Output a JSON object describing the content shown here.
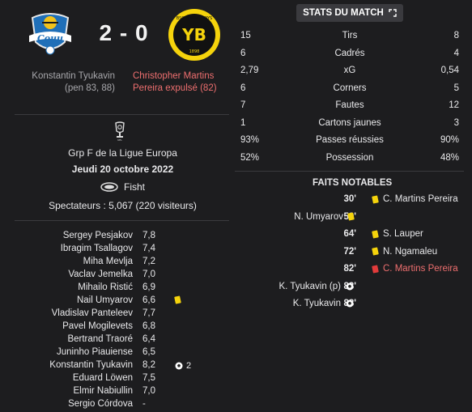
{
  "match": {
    "score": "2 - 0",
    "home_scorers": [
      "Konstantin Tyukavin",
      "(pen 83, 88)"
    ],
    "away_dismissal": [
      "Christopher Martins",
      "Pereira expulsé (82)"
    ],
    "competition": "Grp F de la Ligue Europa",
    "date": "Jeudi 20 octobre 2022",
    "stadium": "Fisht",
    "spectators": "Spectateurs : 5,067 (220 visiteurs)"
  },
  "players": [
    {
      "name": "Sergey Pesjakov",
      "rating": "7,8",
      "event": "",
      "event_icon": ""
    },
    {
      "name": "Ibragim Tsallagov",
      "rating": "7,4",
      "event": "",
      "event_icon": ""
    },
    {
      "name": "Miha Mevlja",
      "rating": "7,2",
      "event": "",
      "event_icon": ""
    },
    {
      "name": "Vaclav Jemelka",
      "rating": "7,0",
      "event": "",
      "event_icon": ""
    },
    {
      "name": "Mihailo Ristić",
      "rating": "6,9",
      "event": "",
      "event_icon": ""
    },
    {
      "name": "Nail Umyarov",
      "rating": "6,6",
      "event": "",
      "event_icon": "yellow-card-icon"
    },
    {
      "name": "Vladislav Panteleev",
      "rating": "7,7",
      "event": "",
      "event_icon": ""
    },
    {
      "name": "Pavel Mogilevets",
      "rating": "6,8",
      "event": "",
      "event_icon": ""
    },
    {
      "name": "Bertrand Traoré",
      "rating": "6,4",
      "event": "",
      "event_icon": ""
    },
    {
      "name": "Juninho Piauiense",
      "rating": "6,5",
      "event": "",
      "event_icon": ""
    },
    {
      "name": "Konstantin Tyukavin",
      "rating": "8,2",
      "event": "2",
      "event_icon": "ball-icon"
    },
    {
      "name": "Eduard Löwen",
      "rating": "7,5",
      "event": "",
      "event_icon": ""
    },
    {
      "name": "Elmir Nabiullin",
      "rating": "7,0",
      "event": "",
      "event_icon": ""
    },
    {
      "name": "Sergio Córdova",
      "rating": "-",
      "event": "",
      "event_icon": ""
    }
  ],
  "stats_title": "STATS DU MATCH",
  "stats": [
    {
      "home": "15",
      "label": "Tirs",
      "away": "8"
    },
    {
      "home": "6",
      "label": "Cadrés",
      "away": "4"
    },
    {
      "home": "2,79",
      "label": "xG",
      "away": "0,54"
    },
    {
      "home": "6",
      "label": "Corners",
      "away": "5"
    },
    {
      "home": "7",
      "label": "Fautes",
      "away": "12"
    },
    {
      "home": "1",
      "label": "Cartons jaunes",
      "away": "3"
    },
    {
      "home": "93%",
      "label": "Passes réussies",
      "away": "90%"
    },
    {
      "home": "52%",
      "label": "Possession",
      "away": "48%"
    }
  ],
  "notable_title": "FAITS NOTABLES",
  "events": [
    {
      "minute": "30'",
      "side": "away",
      "player": "C. Martins Pereira",
      "icon": "yellow-card-icon"
    },
    {
      "minute": "59'",
      "side": "home",
      "player": "N. Umyarov",
      "icon": "yellow-card-icon"
    },
    {
      "minute": "64'",
      "side": "away",
      "player": "S. Lauper",
      "icon": "yellow-card-icon"
    },
    {
      "minute": "72'",
      "side": "away",
      "player": "N. Ngamaleu",
      "icon": "yellow-card-icon"
    },
    {
      "minute": "82'",
      "side": "away",
      "player": "C. Martins Pereira",
      "icon": "red-card-icon"
    },
    {
      "minute": "83'",
      "side": "home",
      "player": "K. Tyukavin (p)",
      "icon": "ball-icon"
    },
    {
      "minute": "88'",
      "side": "home",
      "player": "K. Tyukavin",
      "icon": "ball-icon"
    }
  ],
  "colors": {
    "background": "#1d1d1f",
    "dismissal_text": "#ee6f6f",
    "yellow_card": "#f5d30c",
    "red_card": "#e23b3b",
    "away_crest": "#f5d30c"
  },
  "crests": {
    "home_text": "Сочи",
    "away_letters": "YB",
    "away_ring_text": "BSC YOUNG BOYS",
    "away_year": "1898"
  }
}
